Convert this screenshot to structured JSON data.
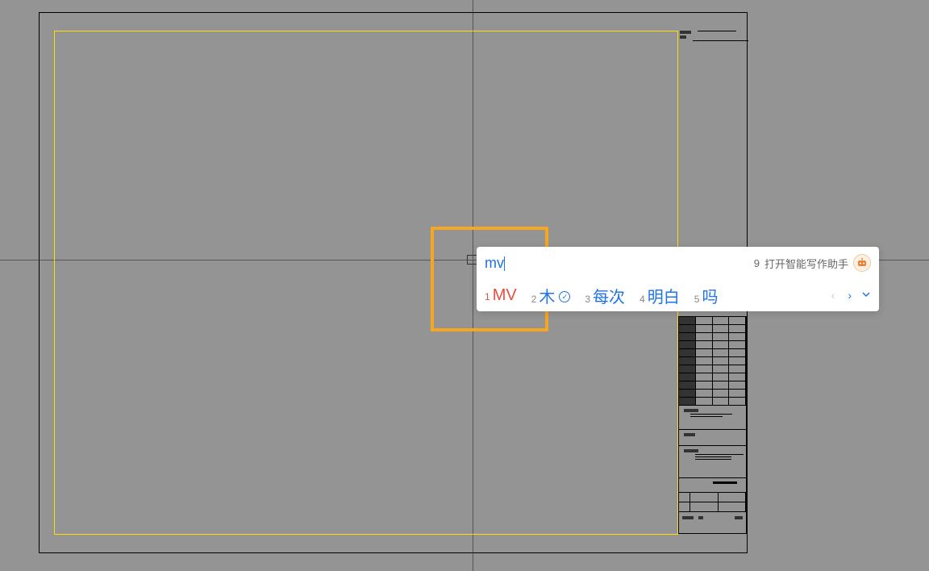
{
  "ime": {
    "input_text": "mv",
    "assistant_label": "打开智能写作助手",
    "assistant_shortcut": "9",
    "candidates": [
      {
        "num": "1",
        "text": "MV",
        "selected": true,
        "cloud": false
      },
      {
        "num": "2",
        "text": "木",
        "selected": false,
        "cloud": true
      },
      {
        "num": "3",
        "text": "每次",
        "selected": false,
        "cloud": false
      },
      {
        "num": "4",
        "text": "明白",
        "selected": false,
        "cloud": false
      },
      {
        "num": "5",
        "text": "吗",
        "selected": false,
        "cloud": false
      }
    ]
  }
}
